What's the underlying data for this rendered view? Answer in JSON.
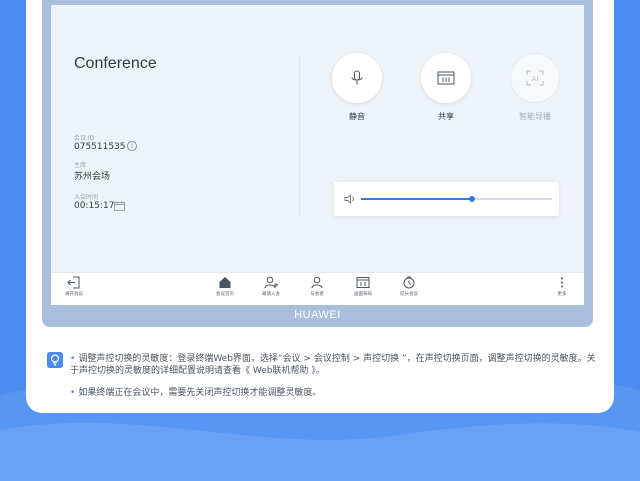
{
  "screen": {
    "title": "Conference",
    "meeting_id_label": "会议 ID",
    "meeting_id": "075511535",
    "host_label": "主席",
    "host": "苏州会场",
    "join_time_label": "入会时间",
    "join_time": "00:15:17"
  },
  "controls": [
    {
      "label": "静音",
      "icon": "microphone-icon",
      "enabled": true
    },
    {
      "label": "共享",
      "icon": "share-screen-icon",
      "enabled": true
    },
    {
      "label": "智能导播",
      "icon": "smart-director-icon",
      "enabled": false
    }
  ],
  "volume": {
    "level": 0.58,
    "icon": "speaker-icon"
  },
  "toolbar": {
    "leave": "离开会议",
    "home": "会议首页",
    "invite": "邀请入会",
    "participants": "与会者",
    "layout": "画面布局",
    "extend": "延长会议",
    "more": "更多"
  },
  "brand": "HUAWEI",
  "tips": [
    "调整声控切换的灵敏度：登录终端Web界面，选择“会议 > 会议控制 > 声控切换 ”，在声控切换页面，调整声控切换的灵敏度。关于声控切换的灵敏度的详细配置说明请查看《 Web联机帮助 》。",
    "如果终端正在会议中，需要先关闭声控切换才能调整灵敏度。"
  ],
  "colors": {
    "background": "#4a8cf0",
    "device_frame": "#a9bedb",
    "screen": "#eef3f8",
    "accent": "#2d7fe0"
  }
}
